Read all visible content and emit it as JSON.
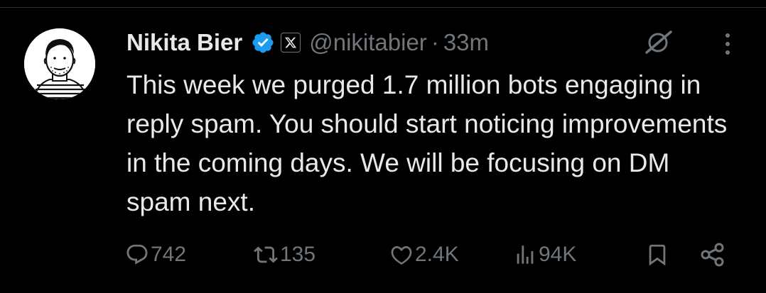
{
  "author": {
    "name": "Nikita Bier",
    "handle": "@nikitabier",
    "separator": "·",
    "time": "33m"
  },
  "tweet_text": "This week we purged 1.7 million bots engaging in reply spam. You should start noticing improvements in the coming days. We will be focusing on DM spam next.",
  "metrics": {
    "replies": "742",
    "reposts": "135",
    "likes": "2.4K",
    "views": "94K"
  },
  "icons": {
    "verified": "verified-badge-icon",
    "affiliation": "x-logo-icon",
    "grok": "grok-icon",
    "more": "more-options-icon",
    "reply": "reply-icon",
    "repost": "repost-icon",
    "like": "heart-icon",
    "views": "views-chart-icon",
    "bookmark": "bookmark-icon",
    "share": "share-icon"
  },
  "colors": {
    "background": "#000000",
    "text": "#e7e9ea",
    "muted": "#71767b",
    "verified": "#1d9bf0"
  }
}
